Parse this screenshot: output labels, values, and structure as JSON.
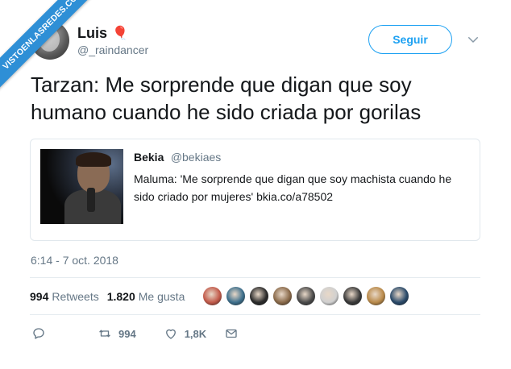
{
  "watermark": {
    "text": "VISTOENLASREDES.COM"
  },
  "author": {
    "display_name": "Luis",
    "name_emoji": "🎈",
    "handle": "@_raindancer"
  },
  "follow_button": {
    "label": "Seguir"
  },
  "tweet": {
    "text": "Tarzan: Me sorprende que digan que soy humano cuando he sido criada por gorilas",
    "timestamp": "6:14 - 7 oct. 2018"
  },
  "quoted_tweet": {
    "name": "Bekia",
    "handle": "@bekiaes",
    "text": "Maluma: 'Me sorprende que digan que soy machista cuando he sido criado por mujeres' bkia.co/a78502"
  },
  "stats": {
    "retweets_count": "994",
    "retweets_label": "Retweets",
    "likes_count": "1.820",
    "likes_label": "Me gusta"
  },
  "liker_avatars": {
    "colors": [
      "#c25a4a",
      "#3d6f8c",
      "#2b2b2b",
      "#8a6a4a",
      "#4a4a4a",
      "#d0d0d0",
      "#3a3a3a",
      "#b98a4a",
      "#2a4a6a"
    ]
  },
  "actions": {
    "reply_icon": "reply-icon",
    "retweet_icon": "retweet-icon",
    "retweet_count": "994",
    "like_icon": "heart-icon",
    "like_count": "1,8K",
    "message_icon": "envelope-icon"
  },
  "colors": {
    "accent": "#1da1f2",
    "secondary_text": "#657786",
    "watermark_bg": "#2e8fd6"
  }
}
